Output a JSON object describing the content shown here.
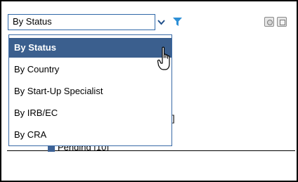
{
  "filter": {
    "selected_value": "By Status",
    "options": [
      "By Status",
      "By Country",
      "By Start-Up Specialist",
      "By IRB/EC",
      "By CRA"
    ],
    "selected_index": 0
  },
  "background": {
    "bracket_text": "]",
    "legend_label": "Pending [10]"
  },
  "colors": {
    "selected_option_bg": "#3b5f8e",
    "filter_icon": "#2d8fd6",
    "legend_swatch": "#3d6296"
  },
  "icons": [
    "chevron-down-icon",
    "filter-icon",
    "settings-icon",
    "minimize-icon",
    "hand-pointer-cursor"
  ]
}
